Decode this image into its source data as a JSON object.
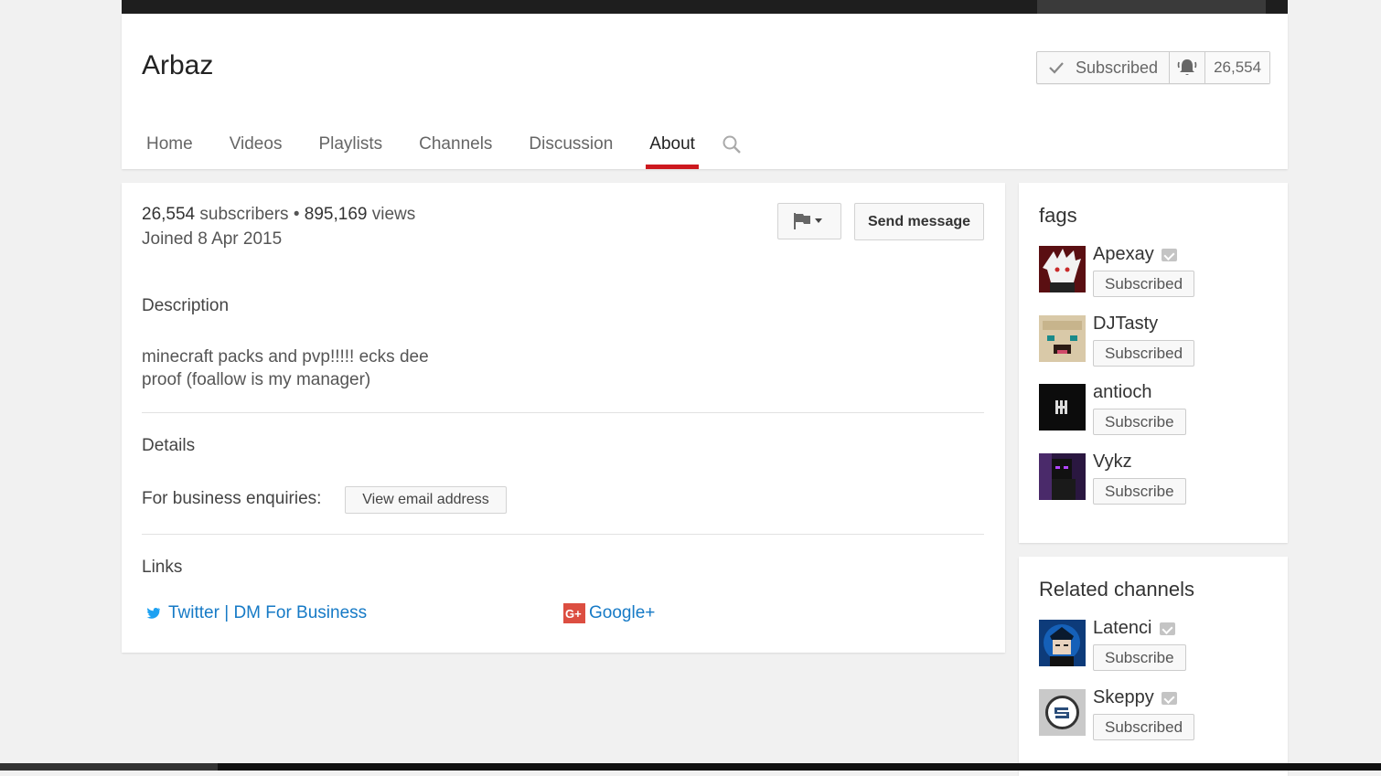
{
  "channel": {
    "name": "Arbaz"
  },
  "subscribe": {
    "label": "Subscribed",
    "count": "26,554"
  },
  "tabs": [
    {
      "label": "Home"
    },
    {
      "label": "Videos"
    },
    {
      "label": "Playlists"
    },
    {
      "label": "Channels"
    },
    {
      "label": "Discussion"
    },
    {
      "label": "About"
    }
  ],
  "active_tab": "About",
  "about": {
    "subscribers_num": "26,554",
    "subscribers_word": "subscribers",
    "separator": "•",
    "views_num": "895,169",
    "views_word": "views",
    "joined": "Joined 8 Apr 2015",
    "send_message": "Send message",
    "description_title": "Description",
    "description_line1": "minecraft packs and pvp!!!!! ecks dee",
    "description_line2": "proof (foallow is my manager)",
    "details_title": "Details",
    "business_label": "For business enquiries:",
    "view_email": "View email address",
    "links_title": "Links",
    "links": [
      {
        "label": "Twitter | DM For Business",
        "icon": "twitter-icon"
      },
      {
        "label": "Google+",
        "icon": "google-plus-icon"
      }
    ]
  },
  "featured": {
    "title": "fags",
    "channels": [
      {
        "name": "Apexay",
        "verified": true,
        "button": "Subscribed"
      },
      {
        "name": "DJTasty",
        "verified": false,
        "button": "Subscribed"
      },
      {
        "name": "antioch",
        "verified": false,
        "button": "Subscribe"
      },
      {
        "name": "Vykz",
        "verified": false,
        "button": "Subscribe"
      }
    ]
  },
  "related": {
    "title": "Related channels",
    "channels": [
      {
        "name": "Latenci",
        "verified": true,
        "button": "Subscribe"
      },
      {
        "name": "Skeppy",
        "verified": true,
        "button": "Subscribed"
      }
    ]
  },
  "colors": {
    "accent": "#cc181e",
    "link": "#167ac6",
    "background": "#f1f1f1"
  }
}
